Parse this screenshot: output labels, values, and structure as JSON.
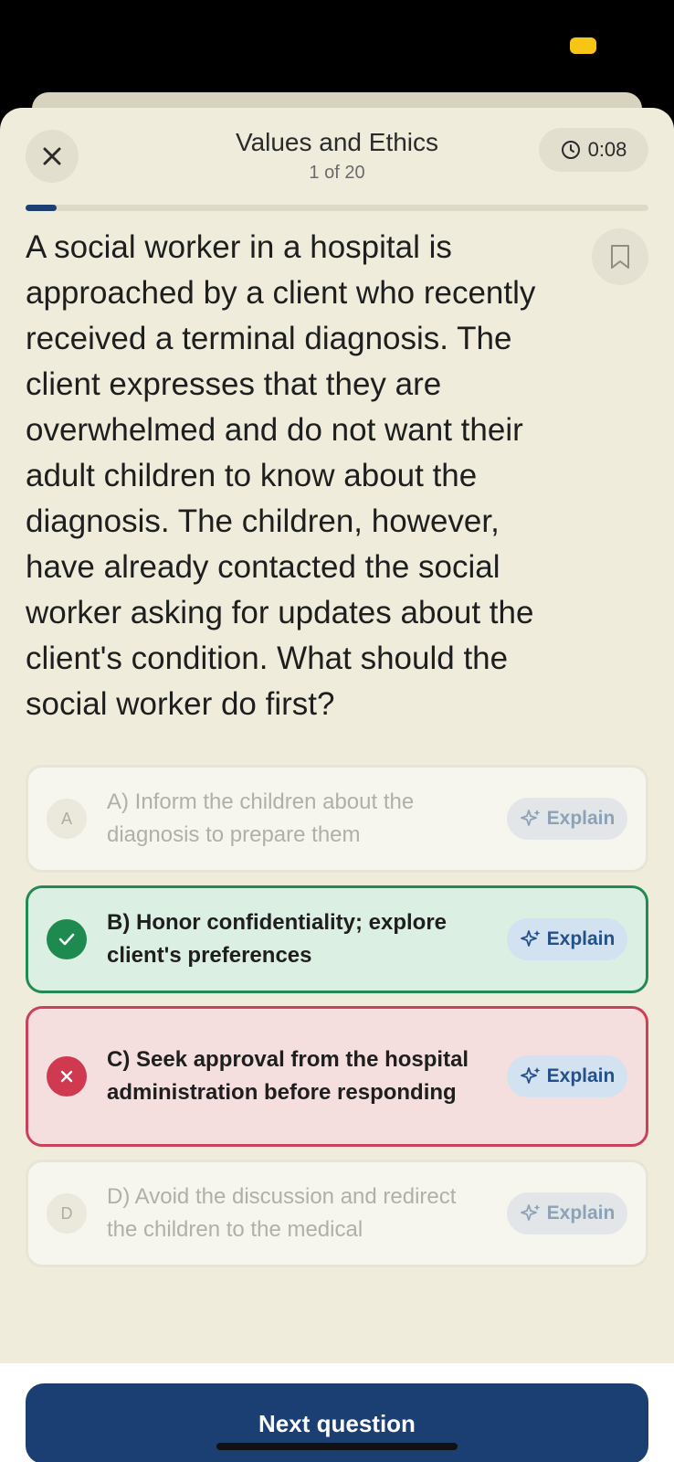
{
  "header": {
    "title": "Values and Ethics",
    "progress_label": "1 of 20",
    "timer": "0:08",
    "progress_fraction": 0.05
  },
  "question": {
    "text": "A social worker in a hospital is approached by a client who recently received a terminal diagnosis. The client expresses that they are overwhelmed and do not want their adult children to know about the diagnosis. The children, however, have already contacted the social worker asking for updates about the client's condition. What should the social worker do first?"
  },
  "options": [
    {
      "letter": "A",
      "text": "A) Inform the children about the diagnosis to prepare them",
      "state": "neutral",
      "explain_label": "Explain"
    },
    {
      "letter": "B",
      "text": "B) Honor confidentiality; explore client's preferences",
      "state": "correct",
      "explain_label": "Explain"
    },
    {
      "letter": "C",
      "text": "C) Seek approval from the hospital administration before responding",
      "state": "incorrect",
      "explain_label": "Explain"
    },
    {
      "letter": "D",
      "text": "D) Avoid the discussion and redirect the children to the medical",
      "state": "neutral",
      "explain_label": "Explain"
    }
  ],
  "footer": {
    "next_label": "Next question"
  },
  "colors": {
    "primary": "#1b3e73",
    "correct": "#1f8a4f",
    "incorrect": "#cf3a51",
    "background": "#efecdc"
  },
  "icons": {
    "close": "close-icon",
    "timer": "clock-icon",
    "bookmark": "bookmark-icon",
    "explain": "sparkle-icon",
    "correct": "check-icon",
    "incorrect": "x-icon"
  }
}
